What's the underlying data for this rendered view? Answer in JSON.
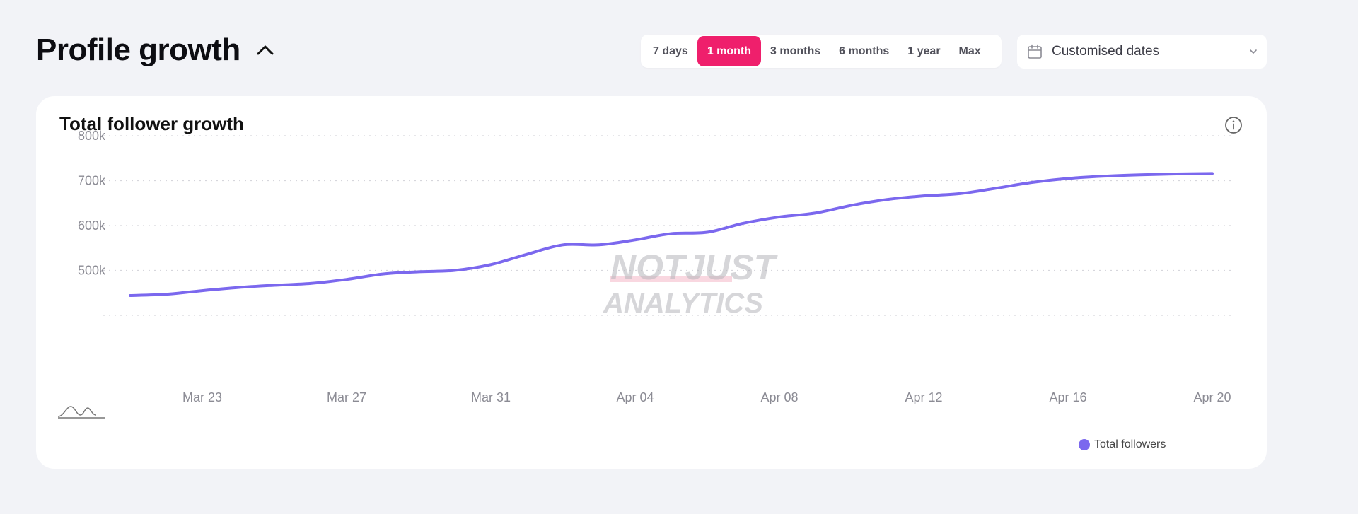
{
  "header": {
    "title": "Profile growth"
  },
  "range_selector": {
    "options": [
      "7 days",
      "1 month",
      "3 months",
      "6 months",
      "1 year",
      "Max"
    ],
    "selected": "1 month"
  },
  "date_picker": {
    "label": "Customised dates"
  },
  "card": {
    "title": "Total follower growth"
  },
  "watermark": {
    "line1": "NOTJUST",
    "line2": "ANALYTICS"
  },
  "colors": {
    "accent": "#ef1f6c",
    "series": "#7b68ee",
    "background": "#f2f3f7"
  },
  "chart_data": {
    "type": "line",
    "title": "Total follower growth",
    "ylim": [
      400000,
      800000
    ],
    "yticks": [
      500000,
      600000,
      700000,
      800000
    ],
    "ytick_labels": [
      "500k",
      "600k",
      "700k",
      "800k"
    ],
    "xlim": [
      "Mar 20",
      "Apr 20"
    ],
    "xtick_labels": [
      "Mar 23",
      "Mar 27",
      "Mar 31",
      "Apr 04",
      "Apr 08",
      "Apr 12",
      "Apr 16",
      "Apr 20"
    ],
    "grid": true,
    "legend_position": "bottom-right",
    "series": [
      {
        "name": "Total followers",
        "x": [
          "Mar 21",
          "Mar 22",
          "Mar 23",
          "Mar 24",
          "Mar 25",
          "Mar 26",
          "Mar 27",
          "Mar 28",
          "Mar 29",
          "Mar 30",
          "Mar 31",
          "Apr 01",
          "Apr 02",
          "Apr 03",
          "Apr 04",
          "Apr 05",
          "Apr 06",
          "Apr 07",
          "Apr 08",
          "Apr 09",
          "Apr 10",
          "Apr 11",
          "Apr 12",
          "Apr 13",
          "Apr 14",
          "Apr 15",
          "Apr 16",
          "Apr 17",
          "Apr 18",
          "Apr 19",
          "Apr 20"
        ],
        "values": [
          444000,
          447000,
          455000,
          462000,
          467000,
          471000,
          480000,
          492000,
          497000,
          500000,
          513000,
          536000,
          557000,
          557000,
          568000,
          582000,
          585000,
          605000,
          619000,
          628000,
          645000,
          658000,
          666000,
          671000,
          683000,
          696000,
          705000,
          710000,
          713000,
          715000,
          716000
        ]
      }
    ]
  }
}
